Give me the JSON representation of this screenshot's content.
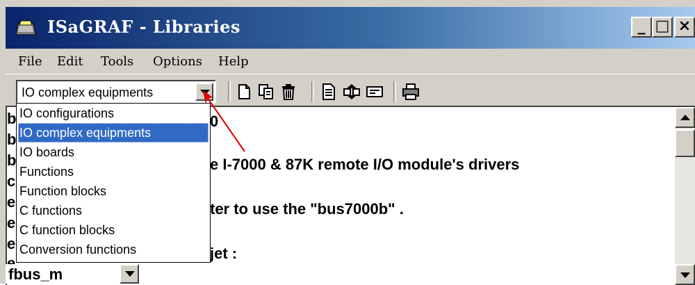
{
  "window": {
    "title": "ISaGRAF - Libraries",
    "controls": {
      "minimize": "_",
      "maximize": "□",
      "close": "×"
    },
    "title_gradient": [
      "#0a246a",
      "#a6caf0"
    ]
  },
  "menu": {
    "items": [
      {
        "label": "File"
      },
      {
        "label": "Edit"
      },
      {
        "label": "Tools"
      },
      {
        "label": "Options"
      },
      {
        "label": "Help"
      }
    ]
  },
  "toolbar": {
    "combo_value": "IO complex equipments",
    "icons": [
      "new-document-icon",
      "copy-icon",
      "delete-icon",
      "properties-icon",
      "import-export-icon",
      "view-icon",
      "print-icon"
    ]
  },
  "dropdown": {
    "selected_index": 1,
    "items": [
      "IO configurations",
      "IO complex equipments",
      "IO boards",
      "Functions",
      "Function blocks",
      "C functions",
      "C function blocks",
      "Conversion functions"
    ]
  },
  "content": {
    "lines": [
      "0",
      "e I-7000 & 87K remote I/O module's drivers",
      "ter to use the \"bus7000b\" .",
      "jet :"
    ],
    "left_fragments": [
      "b",
      "b",
      "b",
      "c",
      "e",
      "e",
      "e",
      "e"
    ]
  },
  "bottom_combo": {
    "value": "fbus_m"
  },
  "colors": {
    "selection": "#316ac5",
    "annotation_arrow": "#e00000"
  }
}
